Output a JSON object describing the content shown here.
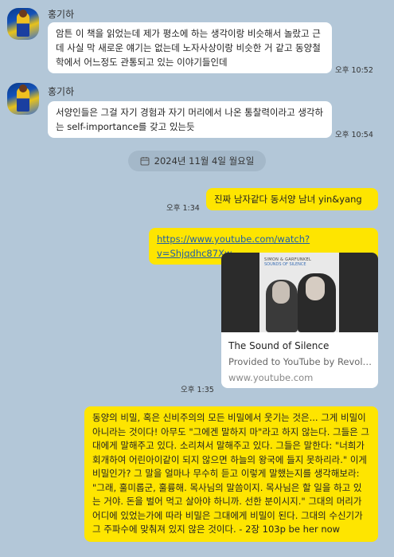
{
  "messages": {
    "m1": {
      "sender": "홍기하",
      "text": "암튼 이 책을 읽었는데 제가 평소에 하는 생각이랑 비슷해서 놀랐고 근데 사실 막 새로운 얘기는 없는데 노자사상이랑 비슷한 거 같고 동양철학에서 어느정도 관통되고 있는 이야기들인데",
      "time": "오후 10:52"
    },
    "m2": {
      "sender": "홍기하",
      "text": "서양인들은 그걸 자기 경험과 자기 머리에서 나온 통찰력이라고 생각하는 self-importance를 갖고 있는듯",
      "time": "오후 10:54"
    },
    "date_separator": "2024년 11월 4일 월요일",
    "m3": {
      "text": "진짜 남자같다 동서양 남녀 yin&yang",
      "time": "오후 1:34"
    },
    "m4": {
      "link": "https://www.youtube.com/watch?v=Shjqdhc87Xw",
      "preview_title": "The Sound of Silence",
      "preview_desc": "Provided to YouTube by Revolv...",
      "preview_domain": "www.youtube.com",
      "album_title": "SIMON & GARFUNKEL",
      "album_sub": "SOUNDS OF SILENCE",
      "time": "오후 1:35"
    },
    "m5": {
      "text": "동양의 비밀, 혹은 신비주의의 모든 비밀에서 웃기는 것은... 그게 비밀이 아니라는 것이다! 아무도 \"그에겐 말하지 마\"라고 하지 않는다. 그들은 그대에게 말해주고 있다. 소리쳐서 말해주고 있다. 그들은 말한다: \"너희가 회개하여 어린아이같이 되지 않으면 하늘의 왕국에 들지 못하리라.\" 이게 비밀인가? 그 말을 얼마나 무수히 듣고 이렇게 말했는지를 생각해보라: \"그래, 훌미롭군, 훌륭해. 목사님의 말씀이지. 목사님은 할 일을 하고 있는 거야. 돈을 벌어 먹고 살아야 하니까. 선한 분이시지.\" 그대의 머리가 어디에 있었는가에 따라 비밀은 그대에게 비밀이 된다. 그대의 수신기가 그 주파수에 맞춰져 있지 않은 것이다. - 2장 103p be her now"
    }
  },
  "icons": {
    "calendar": "calendar-icon"
  },
  "colors": {
    "background": "#b3c7d8",
    "my_bubble": "#fee500",
    "their_bubble": "#ffffff"
  }
}
